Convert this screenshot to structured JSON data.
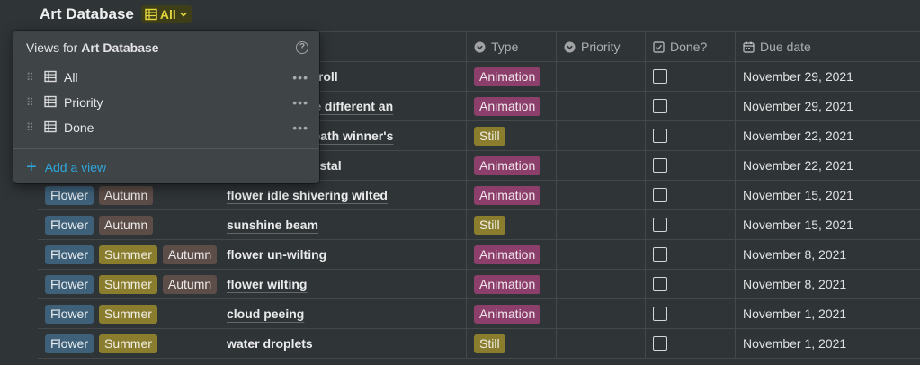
{
  "db_title": "Art Database",
  "current_view": "All",
  "columns": {
    "type": "Type",
    "priority": "Priority",
    "done": "Done?",
    "due": "Due date"
  },
  "rows": [
    {
      "tags": [],
      "name": "…stion from scroll",
      "type": "Animation",
      "due": "November 29, 2021"
    },
    {
      "tags": [],
      "name": "…tforms for the different an",
      "type": "Animation",
      "due": "November 29, 2021"
    },
    {
      "tags": [],
      "name": "…n honey beneath winner's",
      "type": "Still",
      "due": "November 22, 2021"
    },
    {
      "tags": [],
      "name": "…ance on pedestal",
      "type": "Animation",
      "due": "November 22, 2021"
    },
    {
      "tags": [
        "Flower",
        "Autumn"
      ],
      "name": "flower idle shivering wilted",
      "type": "Animation",
      "due": "November 15, 2021"
    },
    {
      "tags": [
        "Flower",
        "Autumn"
      ],
      "name": "sunshine beam",
      "type": "Still",
      "due": "November 15, 2021"
    },
    {
      "tags": [
        "Flower",
        "Summer",
        "Autumn"
      ],
      "name": "flower un-wilting",
      "type": "Animation",
      "due": "November 8, 2021"
    },
    {
      "tags": [
        "Flower",
        "Summer",
        "Autumn"
      ],
      "name": "flower wilting",
      "type": "Animation",
      "due": "November 8, 2021"
    },
    {
      "tags": [
        "Flower",
        "Summer"
      ],
      "name": "cloud peeing",
      "type": "Animation",
      "due": "November 1, 2021"
    },
    {
      "tags": [
        "Flower",
        "Summer"
      ],
      "name": "water droplets",
      "type": "Still",
      "due": "November 1, 2021"
    }
  ],
  "tag_colors": {
    "Flower": "#3e6079",
    "Summer": "#8a7d2e",
    "Autumn": "#5c4d48",
    "Animation": "#8c3f6b",
    "Still": "#8a7d2e"
  },
  "views_menu": {
    "header_prefix": "Views for",
    "header_db": "Art Database",
    "items": [
      "All",
      "Priority",
      "Done"
    ],
    "add_label": "Add a view"
  }
}
